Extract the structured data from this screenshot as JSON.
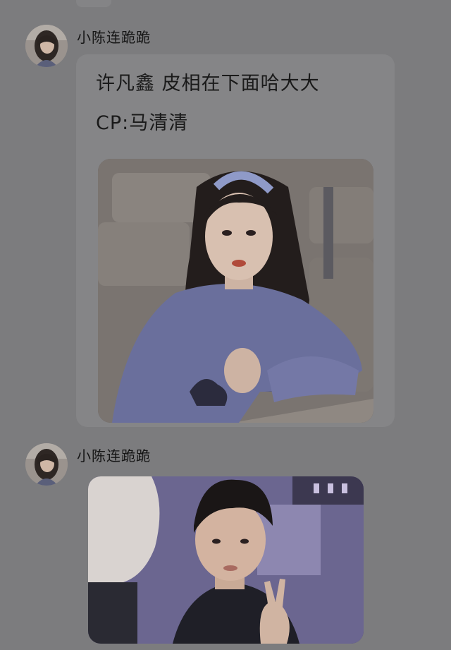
{
  "messages": [
    {
      "nickname": "小陈连跪跪",
      "lines": [
        "许凡鑫 皮相在下面哈大大",
        "CP:马清清"
      ],
      "photo_subject": "girl-portrait"
    },
    {
      "nickname": "小陈连跪跪",
      "lines": [],
      "photo_subject": "boy-portrait"
    }
  ],
  "colors": {
    "background": "#7c7c7e",
    "bubble": "#858587",
    "text": "#1a1a1a"
  }
}
